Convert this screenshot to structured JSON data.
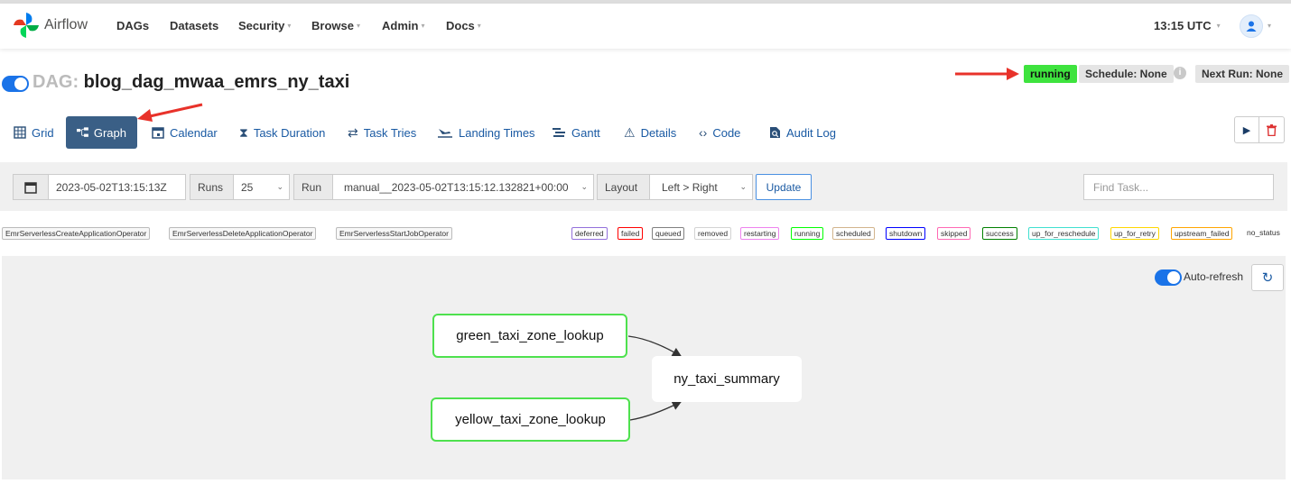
{
  "app": {
    "name": "Airflow"
  },
  "nav": {
    "items": [
      {
        "label": "DAGs",
        "caret": false
      },
      {
        "label": "Datasets",
        "caret": false
      },
      {
        "label": "Security",
        "caret": true
      },
      {
        "label": "Browse",
        "caret": true
      },
      {
        "label": "Admin",
        "caret": true
      },
      {
        "label": "Docs",
        "caret": true
      }
    ],
    "clock": "13:15 UTC"
  },
  "dag": {
    "prefix": "DAG:",
    "id": "blog_dag_mwaa_emrs_ny_taxi",
    "paused": false,
    "state": "running",
    "schedule": "Schedule: None",
    "next_run": "Next Run: None"
  },
  "tabs": [
    {
      "label": "Grid",
      "icon": "grid-icon",
      "active": false
    },
    {
      "label": "Graph",
      "icon": "graph-icon",
      "active": true
    },
    {
      "label": "Calendar",
      "icon": "calendar-icon",
      "active": false
    },
    {
      "label": "Task Duration",
      "icon": "hourglass-icon",
      "active": false
    },
    {
      "label": "Task Tries",
      "icon": "retry-icon",
      "active": false
    },
    {
      "label": "Landing Times",
      "icon": "landing-icon",
      "active": false
    },
    {
      "label": "Gantt",
      "icon": "gantt-icon",
      "active": false
    },
    {
      "label": "Details",
      "icon": "warning-icon",
      "active": false
    },
    {
      "label": "Code",
      "icon": "code-icon",
      "active": false
    },
    {
      "label": "Audit Log",
      "icon": "file-search-icon",
      "active": false
    }
  ],
  "controls": {
    "base_date": "2023-05-02T13:15:13Z",
    "runs_label": "Runs",
    "runs_value": "25",
    "run_label": "Run",
    "run_value": "manual__2023-05-02T13:15:12.132821+00:00",
    "layout_label": "Layout",
    "layout_value": "Left > Right",
    "update_label": "Update",
    "find_placeholder": "Find Task..."
  },
  "operators": [
    "EmrServerlessCreateApplicationOperator",
    "EmrServerlessDeleteApplicationOperator",
    "EmrServerlessStartJobOperator"
  ],
  "states": [
    {
      "label": "deferred",
      "color": "#9370db"
    },
    {
      "label": "failed",
      "color": "#ff0000"
    },
    {
      "label": "queued",
      "color": "#808080"
    },
    {
      "label": "removed",
      "color": "#d3d3d3"
    },
    {
      "label": "restarting",
      "color": "#ee82ee"
    },
    {
      "label": "running",
      "color": "#00ff00"
    },
    {
      "label": "scheduled",
      "color": "#d2b48c"
    },
    {
      "label": "shutdown",
      "color": "#0000ff"
    },
    {
      "label": "skipped",
      "color": "#ff69b4"
    },
    {
      "label": "success",
      "color": "#008000"
    },
    {
      "label": "up_for_reschedule",
      "color": "#40e0d0"
    },
    {
      "label": "up_for_retry",
      "color": "#ffd700"
    },
    {
      "label": "upstream_failed",
      "color": "#ffa500"
    },
    {
      "label": "no_status",
      "color": ""
    }
  ],
  "graph": {
    "auto_refresh_label": "Auto-refresh",
    "auto_refresh_on": true,
    "nodes": [
      {
        "id": "green_taxi_zone_lookup",
        "state": "running"
      },
      {
        "id": "yellow_taxi_zone_lookup",
        "state": "running"
      },
      {
        "id": "ny_taxi_summary",
        "state": "no_status"
      }
    ],
    "edges": [
      [
        "green_taxi_zone_lookup",
        "ny_taxi_summary"
      ],
      [
        "yellow_taxi_zone_lookup",
        "ny_taxi_summary"
      ]
    ]
  },
  "colors": {
    "accent": "#1a73e8",
    "active_tab": "#3a5f86",
    "running": "#3ee33e",
    "annotation": "#e8322a"
  }
}
